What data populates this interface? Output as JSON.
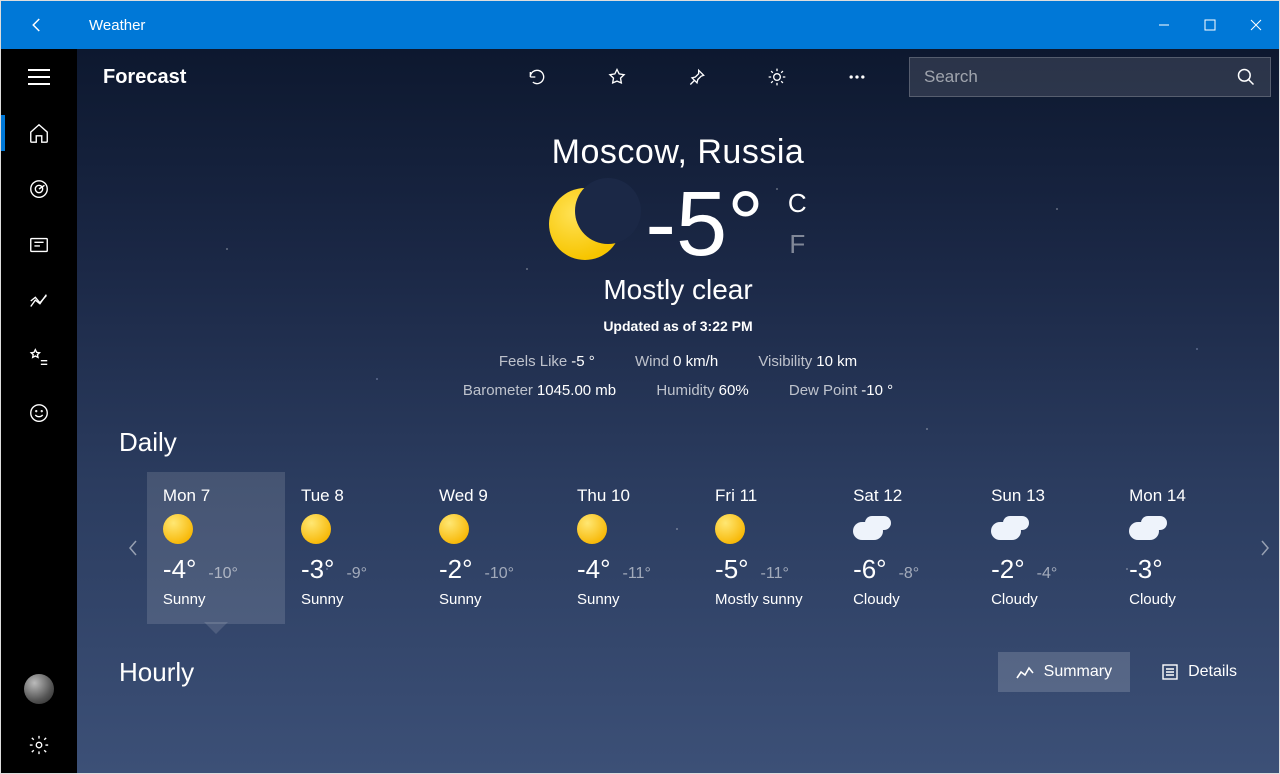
{
  "window": {
    "title": "Weather"
  },
  "toolbar": {
    "section": "Forecast",
    "search_placeholder": "Search"
  },
  "current": {
    "location": "Moscow, Russia",
    "temp": "-5°",
    "unit_primary": "C",
    "unit_secondary": "F",
    "condition": "Mostly clear",
    "updated": "Updated as of 3:22 PM",
    "metrics": {
      "feels_like_label": "Feels Like",
      "feels_like": "-5 °",
      "wind_label": "Wind",
      "wind": "0 km/h",
      "visibility_label": "Visibility",
      "visibility": "10 km",
      "barometer_label": "Barometer",
      "barometer": "1045.00 mb",
      "humidity_label": "Humidity",
      "humidity": "60%",
      "dewpoint_label": "Dew Point",
      "dewpoint": "-10 °"
    }
  },
  "sections": {
    "daily": "Daily",
    "hourly": "Hourly",
    "summary": "Summary",
    "details": "Details"
  },
  "daily": [
    {
      "label": "Mon 7",
      "icon": "sunny",
      "hi": "-4°",
      "lo": "-10°",
      "cond": "Sunny",
      "selected": true
    },
    {
      "label": "Tue 8",
      "icon": "sunny",
      "hi": "-3°",
      "lo": "-9°",
      "cond": "Sunny"
    },
    {
      "label": "Wed 9",
      "icon": "sunny",
      "hi": "-2°",
      "lo": "-10°",
      "cond": "Sunny"
    },
    {
      "label": "Thu 10",
      "icon": "sunny",
      "hi": "-4°",
      "lo": "-11°",
      "cond": "Sunny"
    },
    {
      "label": "Fri 11",
      "icon": "sunny",
      "hi": "-5°",
      "lo": "-11°",
      "cond": "Mostly sunny"
    },
    {
      "label": "Sat 12",
      "icon": "cloudy",
      "hi": "-6°",
      "lo": "-8°",
      "cond": "Cloudy"
    },
    {
      "label": "Sun 13",
      "icon": "cloudy",
      "hi": "-2°",
      "lo": "-4°",
      "cond": "Cloudy"
    },
    {
      "label": "Mon 14",
      "icon": "cloudy",
      "hi": "-3°",
      "lo": "",
      "cond": "Cloudy"
    }
  ]
}
